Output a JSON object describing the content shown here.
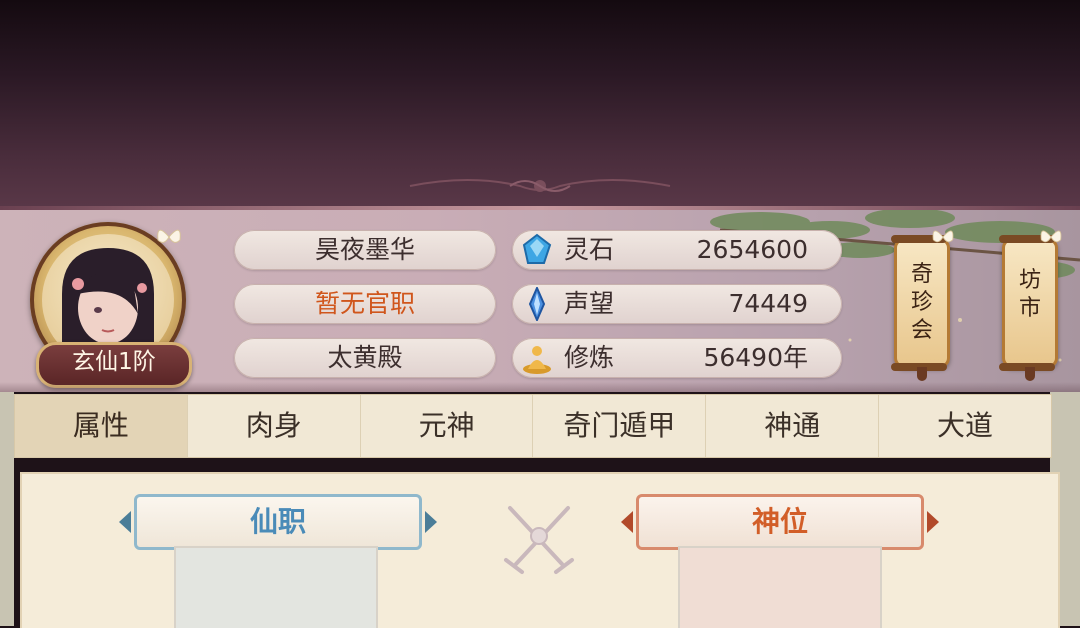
{
  "player": {
    "name": "昊夜墨华",
    "official_title": "暂无官职",
    "sect": "太黄殿",
    "rank": "玄仙1阶"
  },
  "stats": [
    {
      "label": "灵石",
      "value": "2654600",
      "icon": "spirit-stone-icon"
    },
    {
      "label": "声望",
      "value": "74449",
      "icon": "reputation-crystal-icon"
    },
    {
      "label": "修炼",
      "value": "56490年",
      "icon": "cultivation-meditation-icon"
    }
  ],
  "shops": [
    {
      "label": "奇珍会",
      "chars": [
        "奇",
        "珍",
        "会"
      ]
    },
    {
      "label": "坊市",
      "chars": [
        "坊",
        "市"
      ]
    }
  ],
  "tabs": [
    "属性",
    "肉身",
    "元神",
    "奇门遁甲",
    "神通",
    "大道"
  ],
  "active_tab": "属性",
  "sections": {
    "left_title": "仙职",
    "right_title": "神位"
  },
  "colors": {
    "official_title": "#d0561c",
    "left_ribbon": "#4a8bb8",
    "right_ribbon": "#d25e28"
  }
}
